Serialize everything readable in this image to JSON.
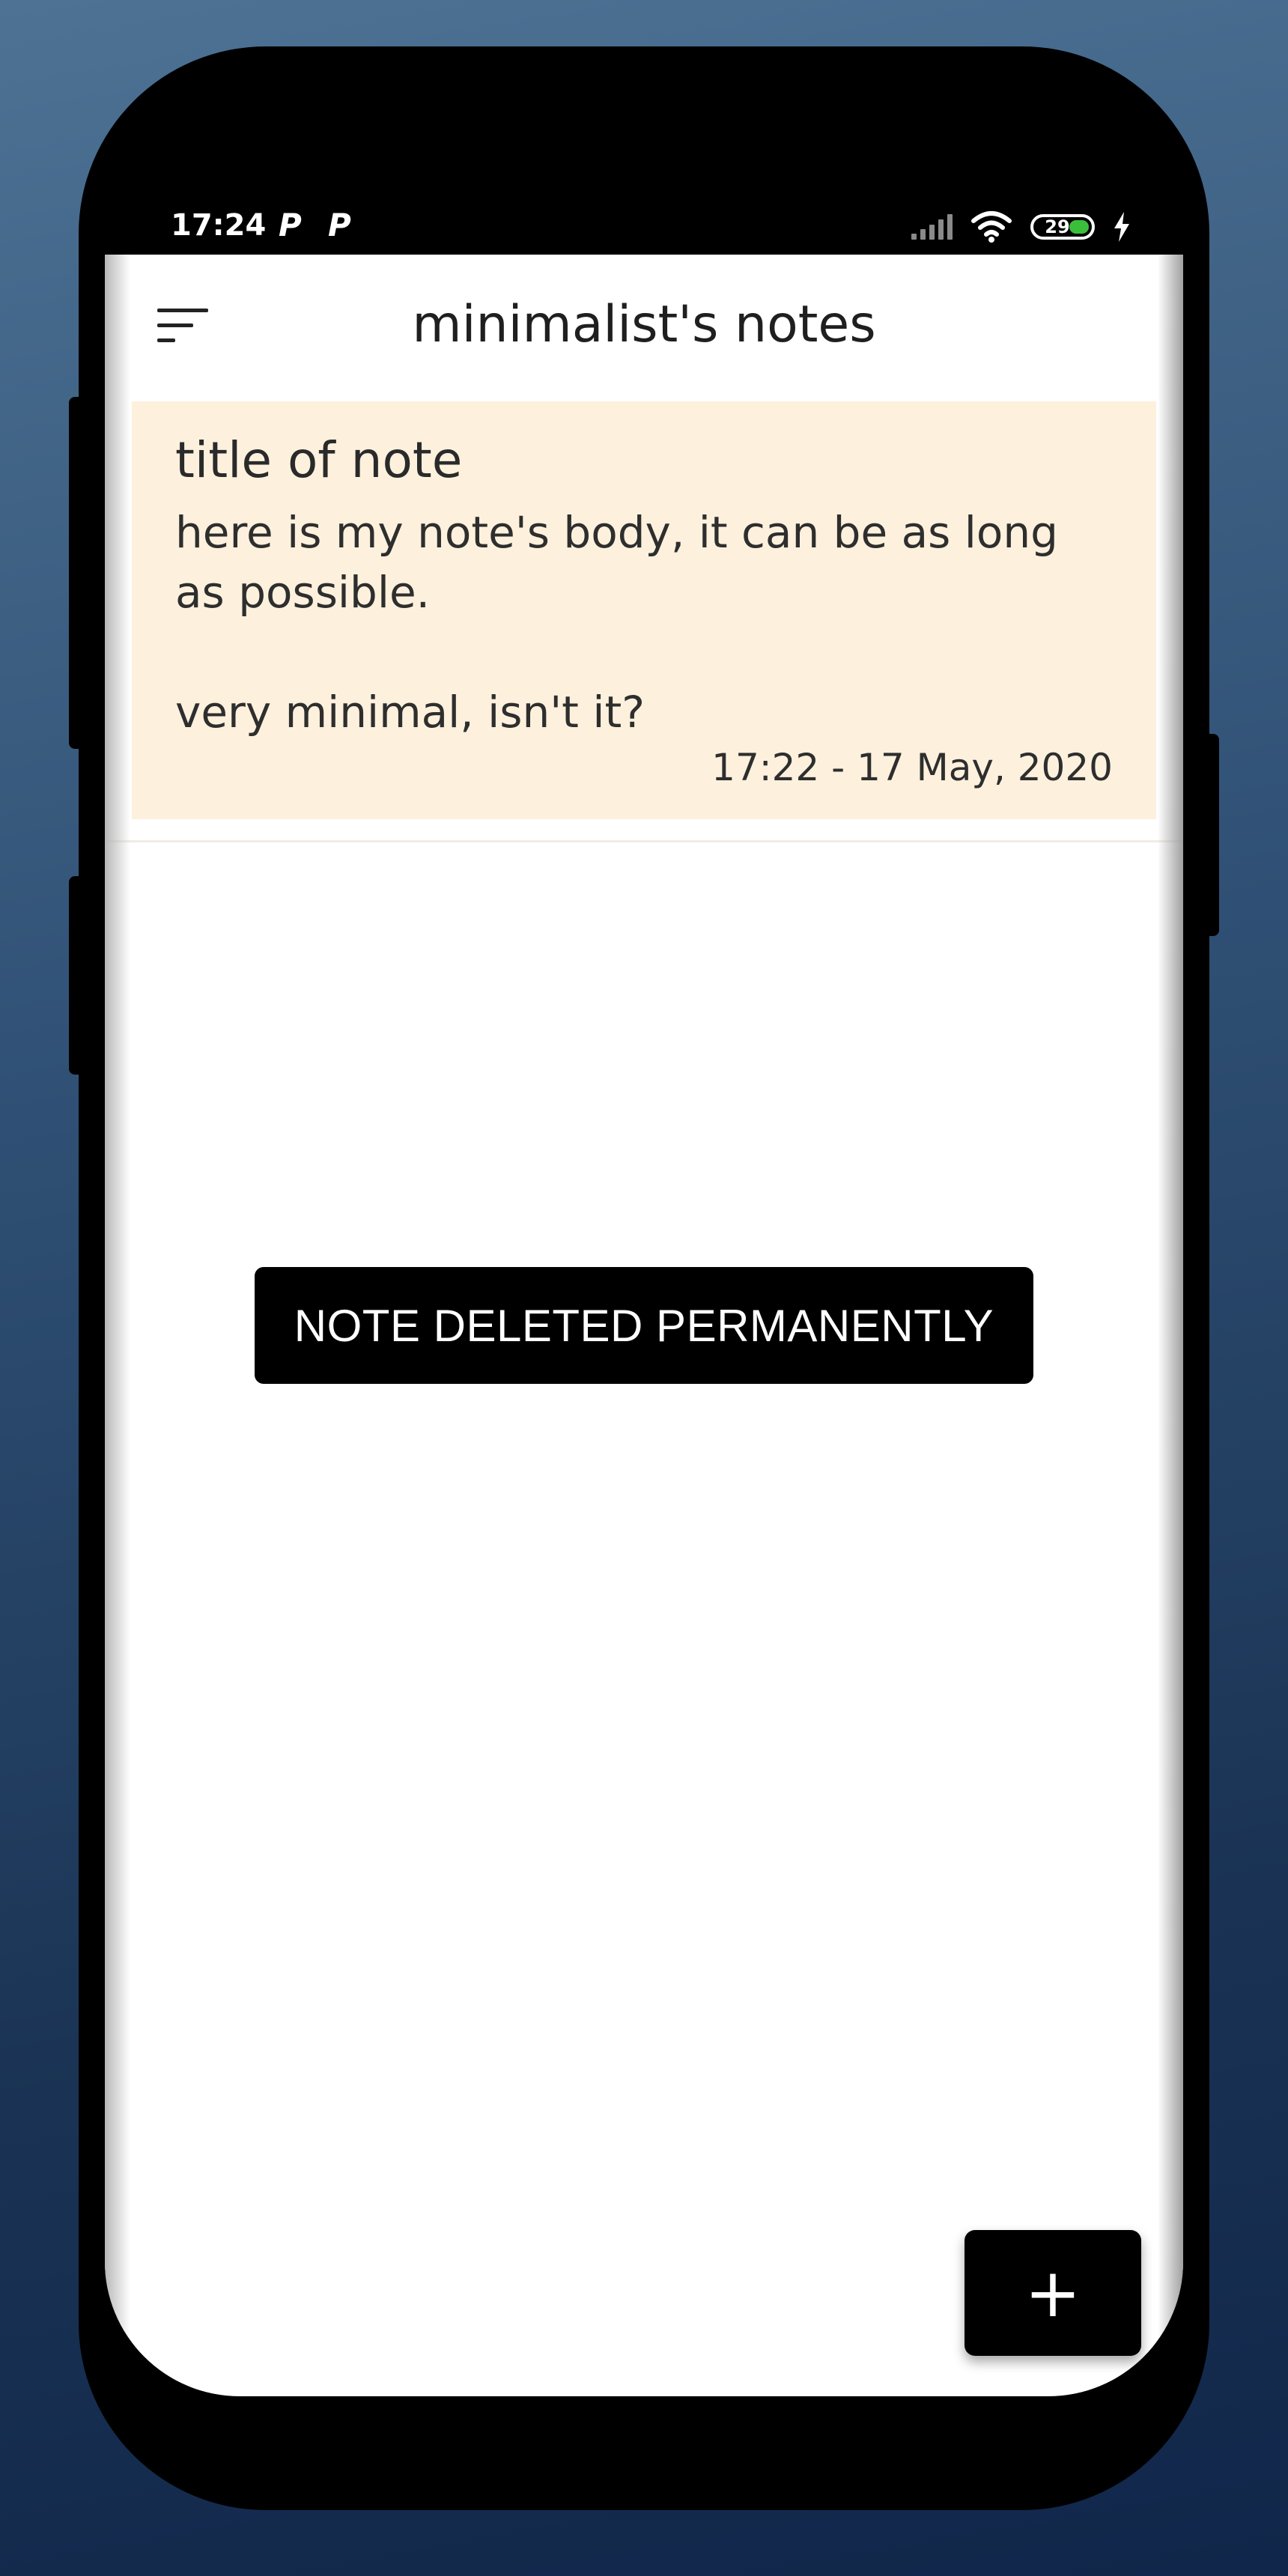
{
  "status_bar": {
    "time": "17:24",
    "notif_icons": [
      "P",
      "P"
    ],
    "battery_level": "29"
  },
  "app_bar": {
    "title": "minimalist's notes"
  },
  "notes": [
    {
      "title": "title of note",
      "body": "here is my note's body, it can be as long as possible.\n\nvery minimal, isn't it?",
      "date": "17:22 - 17 May, 2020",
      "color": "#fdf1dd"
    }
  ],
  "toast": {
    "message": "NOTE DELETED PERMANENTLY"
  },
  "fab": {
    "label": "+"
  }
}
